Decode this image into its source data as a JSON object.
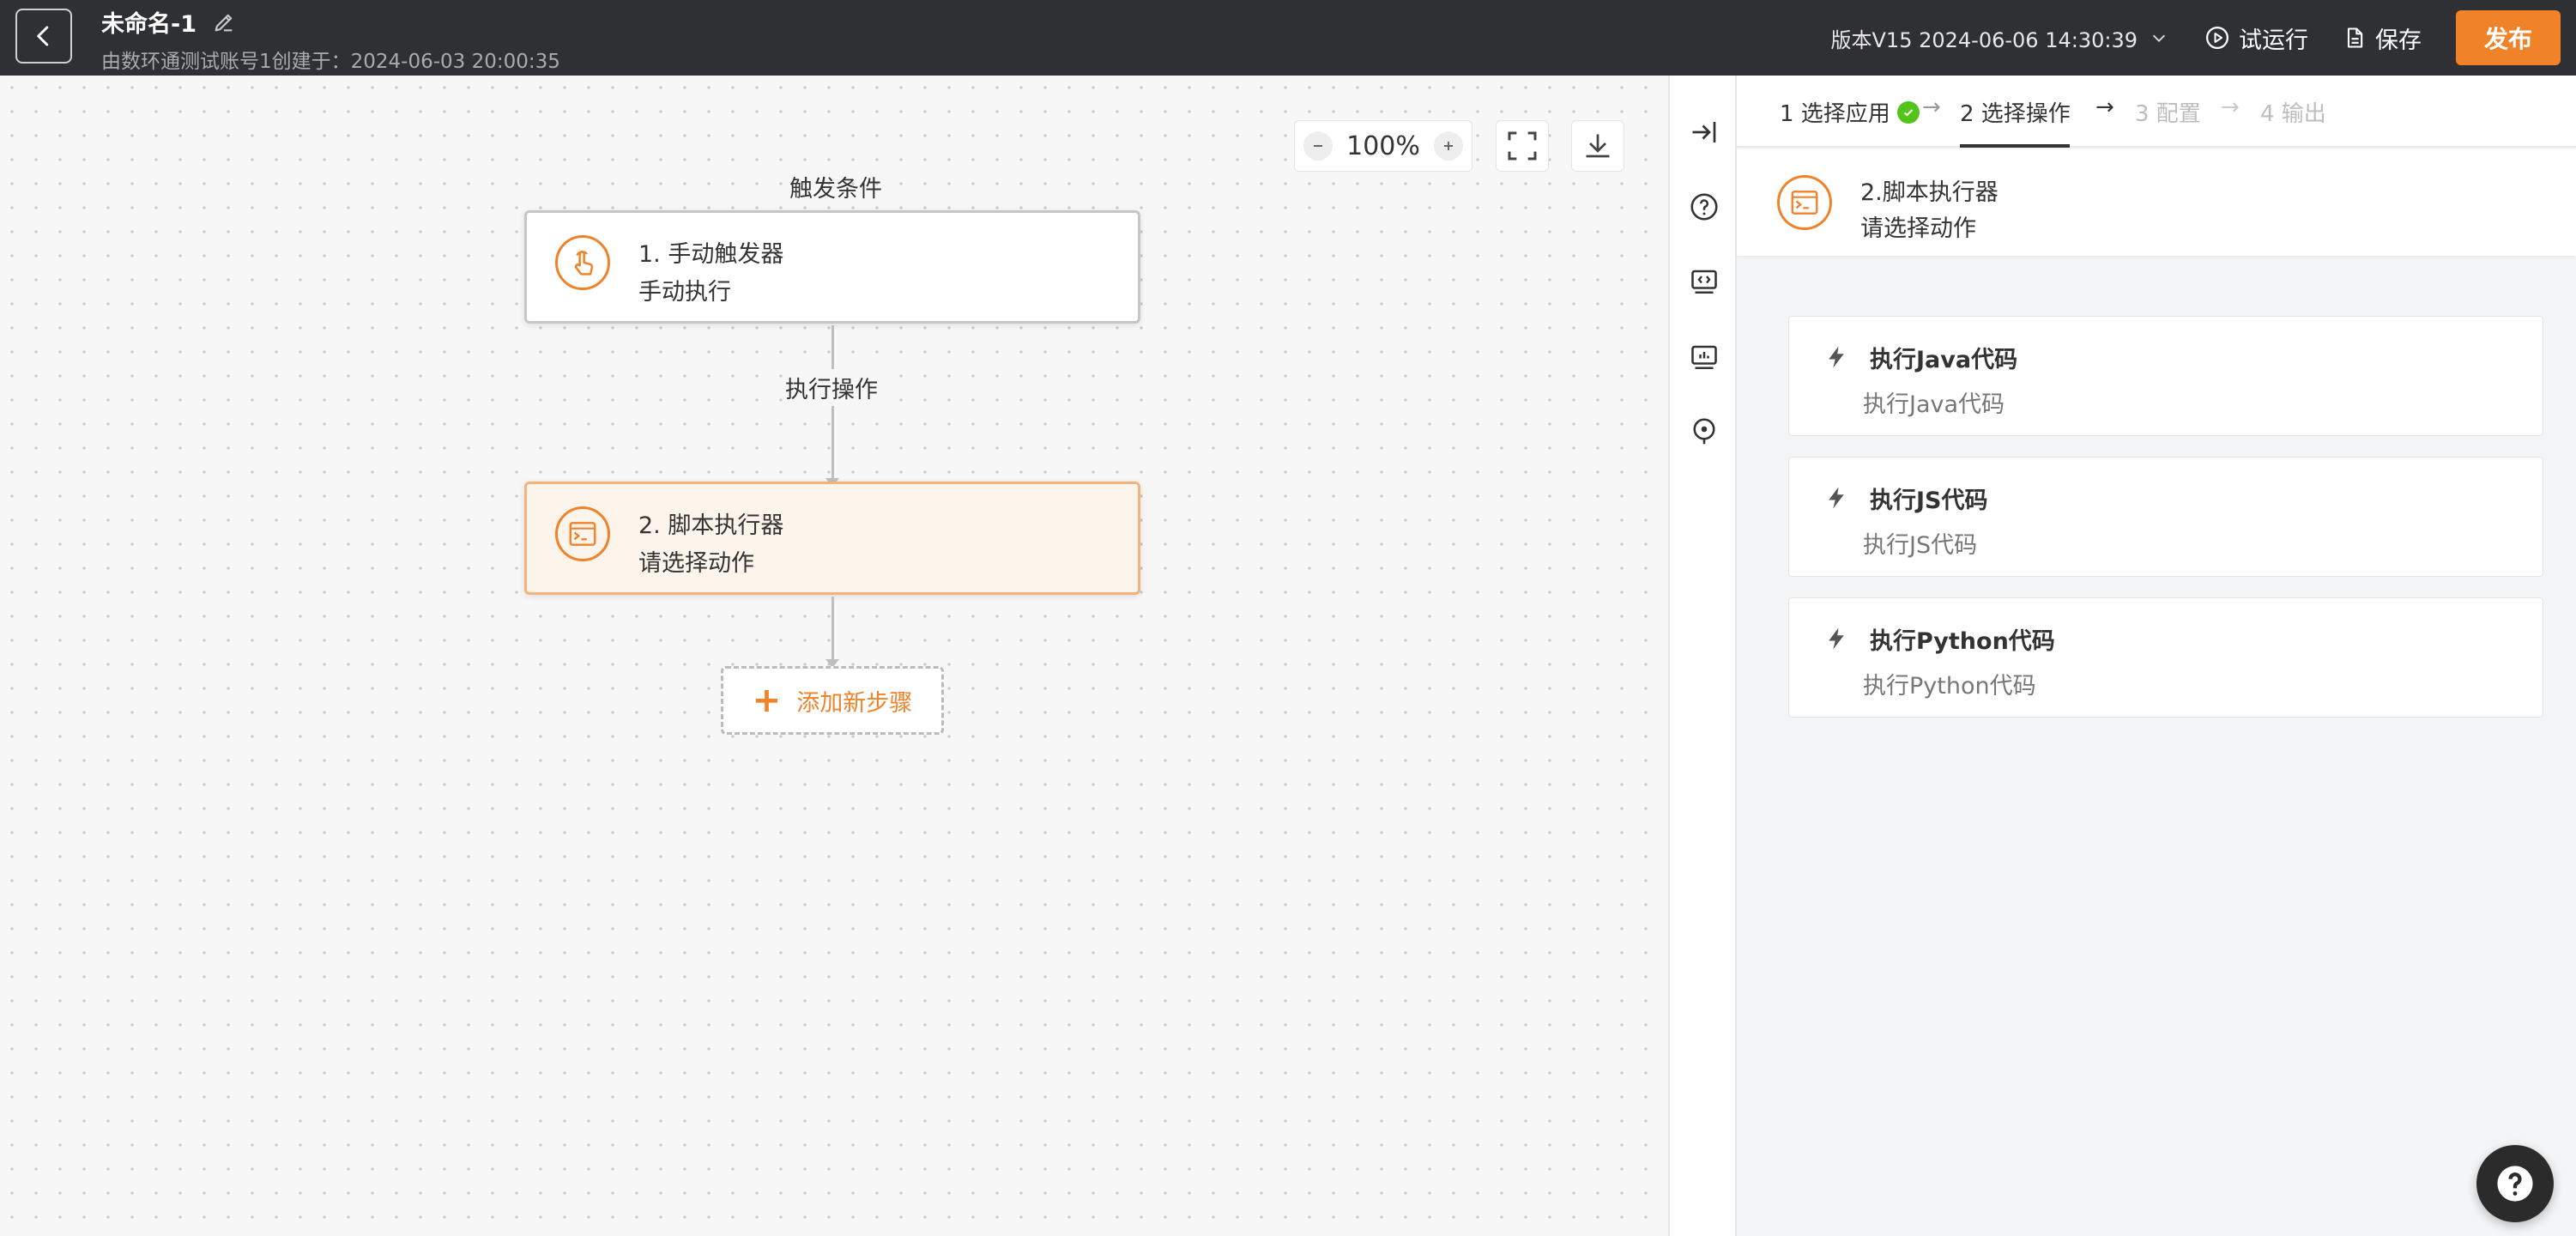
{
  "header": {
    "title": "未命名-1",
    "subtitle": "由数环通测试账号1创建于：2024-06-03 20:00:35",
    "version": "版本V15 2024-06-06 14:30:39",
    "trial_run": "试运行",
    "save": "保存",
    "publish": "发布"
  },
  "canvas": {
    "zoom": "100%",
    "trigger_label": "触发条件",
    "action_label": "执行操作",
    "nodes": [
      {
        "title": "1. 手动触发器",
        "desc": "手动执行"
      },
      {
        "title": "2. 脚本执行器",
        "desc": "请选择动作"
      }
    ],
    "add_step": "添加新步骤"
  },
  "panel": {
    "steps": [
      {
        "label": "1 选择应用",
        "state": "done"
      },
      {
        "label": "2 选择操作",
        "state": "active"
      },
      {
        "label": "3 配置",
        "state": "disabled"
      },
      {
        "label": "4 输出",
        "state": "disabled"
      }
    ],
    "selected_app": {
      "title": "2.脚本执行器",
      "desc": "请选择动作"
    },
    "actions": [
      {
        "title": "执行Java代码",
        "desc": "执行Java代码"
      },
      {
        "title": "执行JS代码",
        "desc": "执行JS代码"
      },
      {
        "title": "执行Python代码",
        "desc": "执行Python代码"
      }
    ]
  },
  "colors": {
    "accent": "#f0832a",
    "header_bg": "#2f3033",
    "success": "#52c41a"
  }
}
